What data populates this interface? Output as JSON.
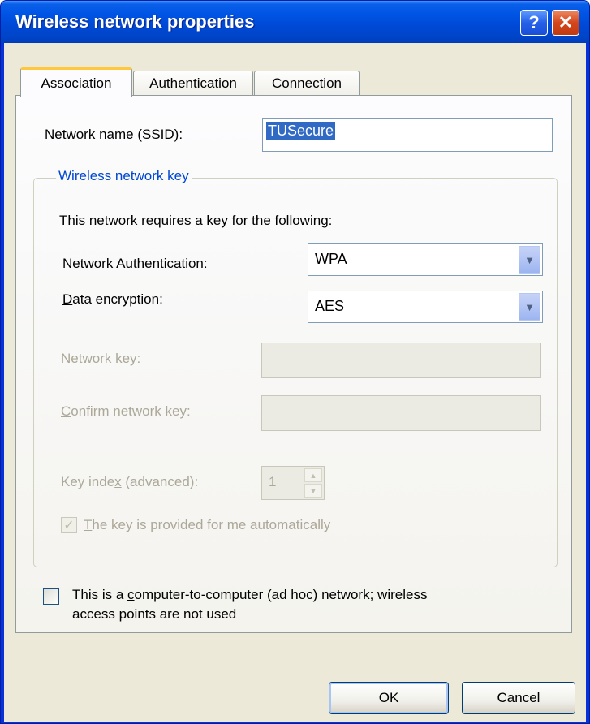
{
  "window": {
    "title": "Wireless network properties",
    "help_glyph": "?",
    "close_glyph": "✕"
  },
  "tabs": [
    {
      "label": "Association",
      "active": true
    },
    {
      "label": "Authentication",
      "active": false
    },
    {
      "label": "Connection",
      "active": false
    }
  ],
  "association": {
    "ssid_label_pre": "Network ",
    "ssid_label_key": "n",
    "ssid_label_post": "ame (SSID):",
    "ssid_value": "TUSecure",
    "group_title": "Wireless network key",
    "requires_text": "This network requires a key for the following:",
    "auth_label_pre": "Network ",
    "auth_label_key": "A",
    "auth_label_post": "uthentication:",
    "auth_value": "WPA",
    "enc_label_key": "D",
    "enc_label_post": "ata encryption:",
    "enc_value": "AES",
    "netkey_label_pre": "Network ",
    "netkey_label_key": "k",
    "netkey_label_post": "ey:",
    "confirm_label_key": "C",
    "confirm_label_post": "onfirm network key:",
    "keyindex_label_pre": "Key inde",
    "keyindex_label_key": "x",
    "keyindex_label_post": " (advanced):",
    "keyindex_value": "1",
    "auto_key_checked_glyph": "✓",
    "auto_key_label_key": "T",
    "auto_key_label_post": "he key is provided for me automatically",
    "adhoc_label_pre": "This is a ",
    "adhoc_label_key": "c",
    "adhoc_label_post": "omputer-to-computer (ad hoc) network; wireless",
    "adhoc_label_line2": "access points are not used"
  },
  "buttons": {
    "ok": "OK",
    "cancel": "Cancel"
  },
  "icons": {
    "dropdown_arrow": "▼",
    "spin_up": "▲",
    "spin_down": "▼"
  },
  "colors": {
    "titlebar": "#0055e5",
    "face": "#ece9d8",
    "group_title": "#0046d5",
    "selection": "#316ac5",
    "disabled_text": "#aca899"
  }
}
